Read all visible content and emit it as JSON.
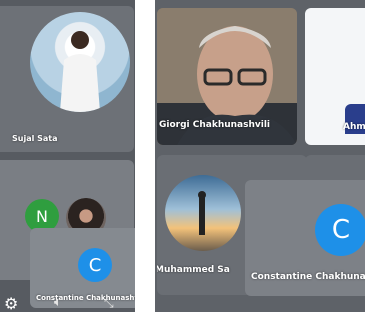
{
  "left_panel": {
    "tile_sujal": {
      "name": "Sujal Sata"
    },
    "avatar_n": {
      "letter": "N",
      "color": "#2f9e3f"
    },
    "tile_constantine": {
      "initial": "C",
      "name": "Constantine Chakhunashvili"
    },
    "toolbar_icons": [
      "gear-icon",
      "speaker-icon",
      "expand-icon"
    ]
  },
  "right_panel": {
    "tile_giorgi": {
      "name": "Giorgi Chakhunashvili"
    },
    "tile_partial": {
      "name": "Ahmed To"
    },
    "tile_muhammed": {
      "name": "Muhammed Sa"
    },
    "tile_constantine": {
      "initial": "C",
      "name": "Constantine Chakhunashvili"
    }
  },
  "colors": {
    "avatar_blue": "#1e90e8",
    "panel_bg": "#575b61"
  }
}
